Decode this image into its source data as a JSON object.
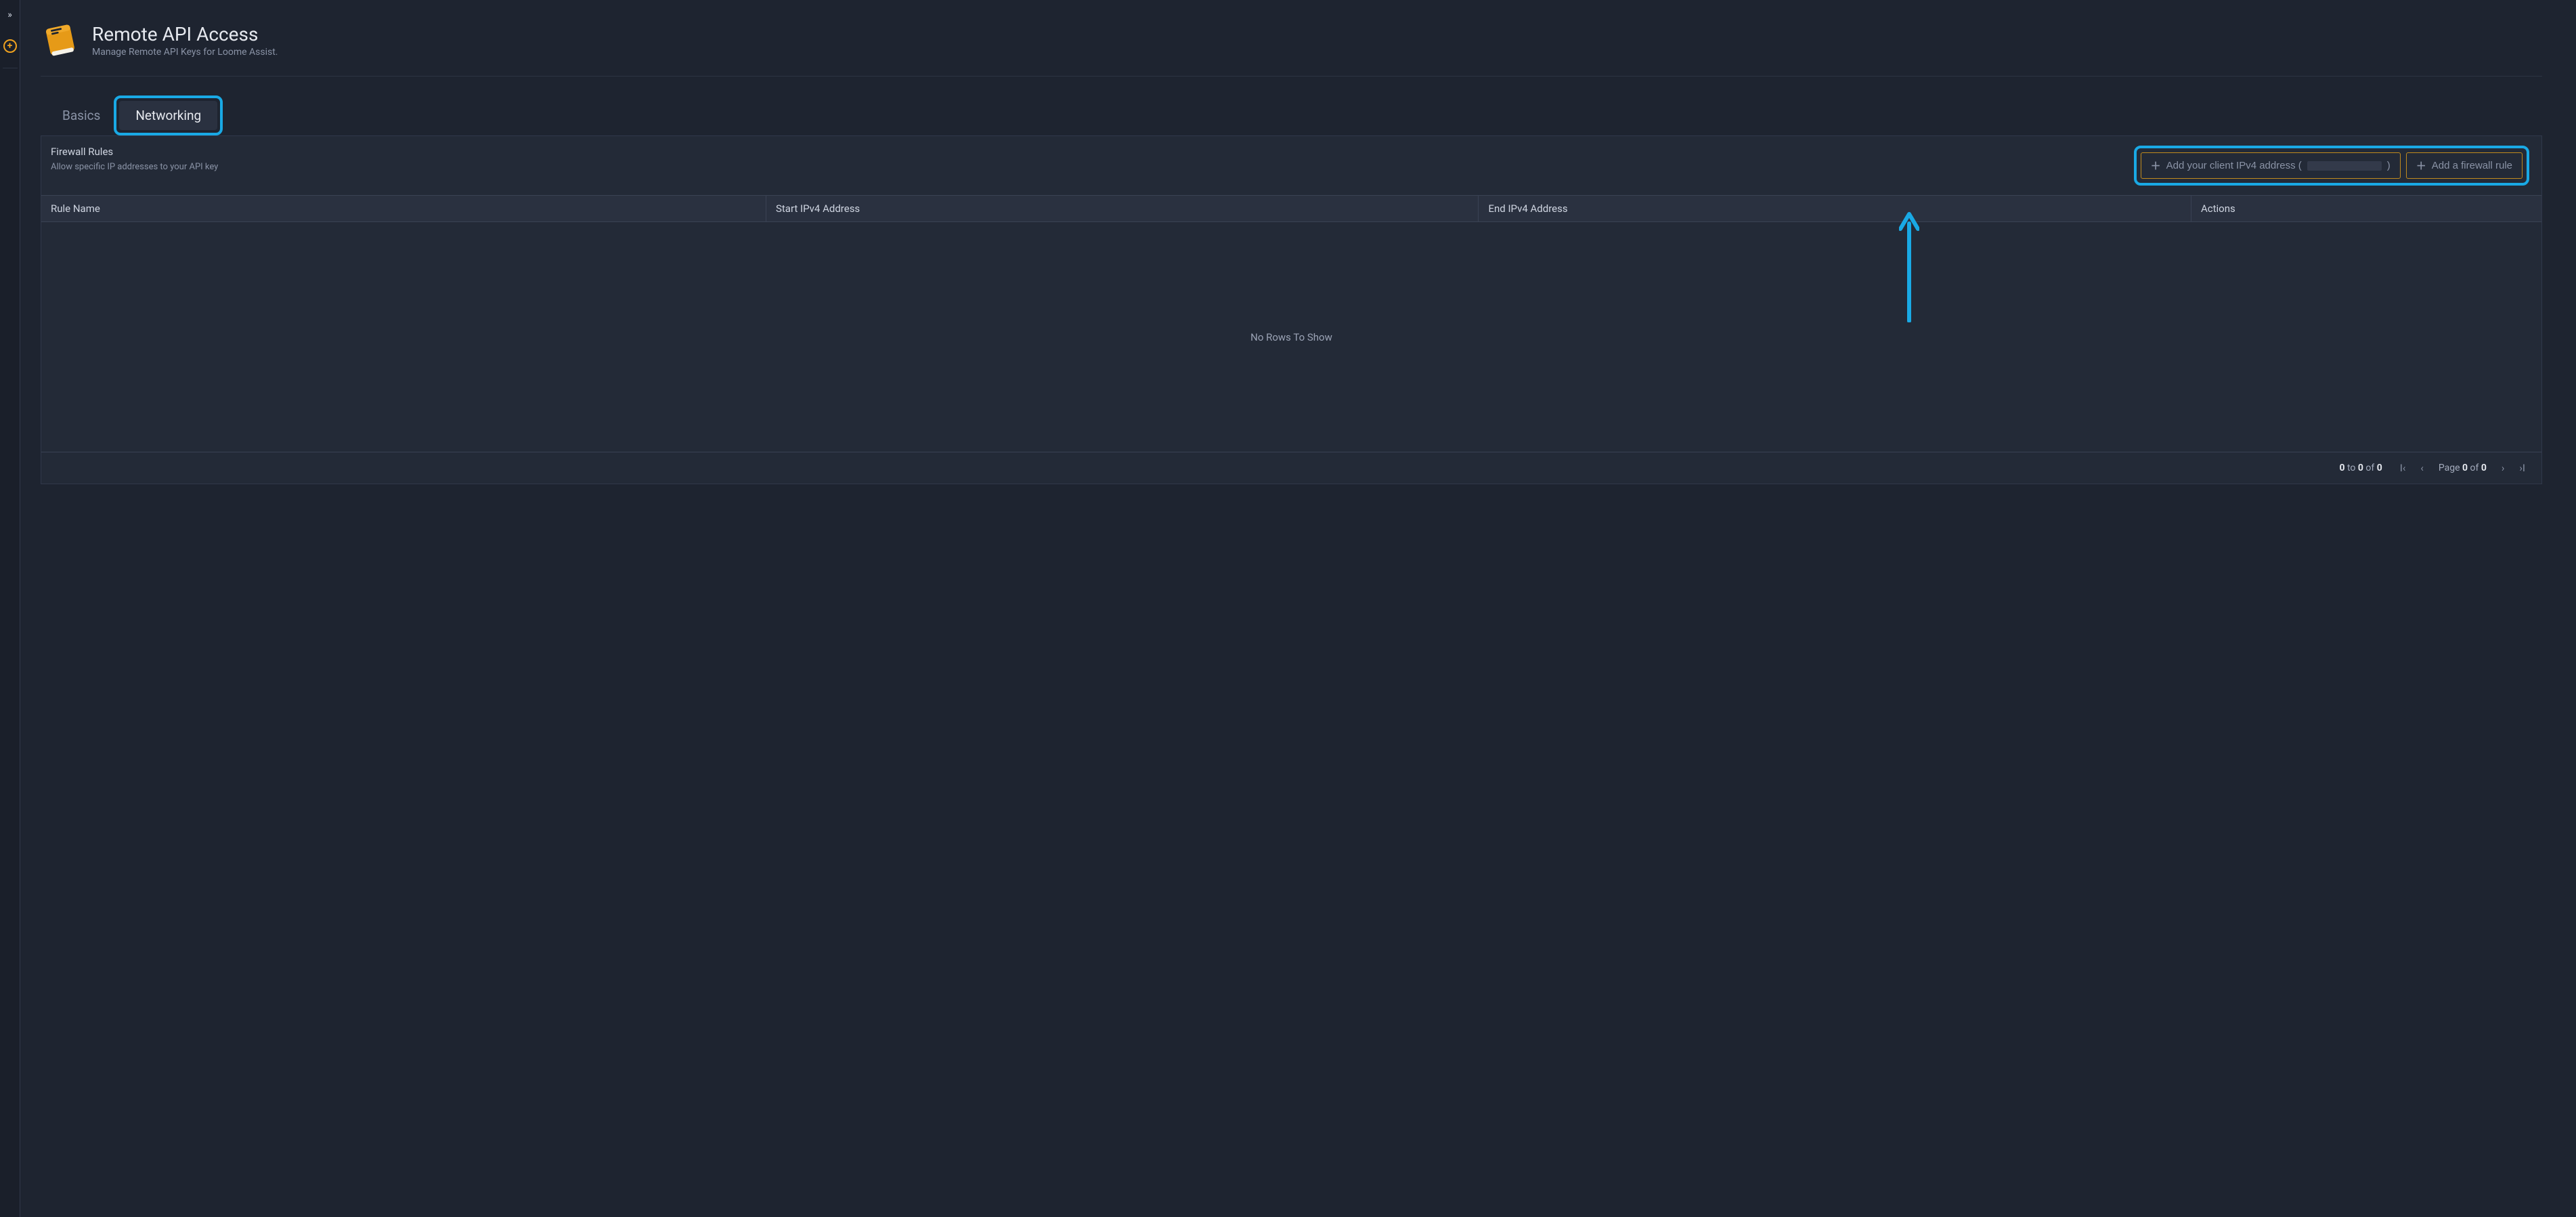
{
  "rail": {
    "expand_icon": "»",
    "add_icon": "+"
  },
  "header": {
    "title": "Remote API Access",
    "subtitle": "Manage Remote API Keys for Loome Assist."
  },
  "tabs": {
    "basics": "Basics",
    "networking": "Networking"
  },
  "firewall": {
    "title": "Firewall Rules",
    "desc": "Allow specific IP addresses to your API key",
    "add_client_prefix": "Add your client IPv4 address (",
    "add_client_suffix": ")",
    "add_rule": "Add a firewall rule"
  },
  "table": {
    "headers": {
      "rule": "Rule Name",
      "start": "Start IPv4 Address",
      "end": "End IPv4 Address",
      "actions": "Actions"
    },
    "empty": "No Rows To Show"
  },
  "pagination": {
    "from": "0",
    "to_word": " to ",
    "to": "0",
    "of_word": " of ",
    "total": "0",
    "page_word": "Page ",
    "page": "0",
    "pages": "0"
  }
}
